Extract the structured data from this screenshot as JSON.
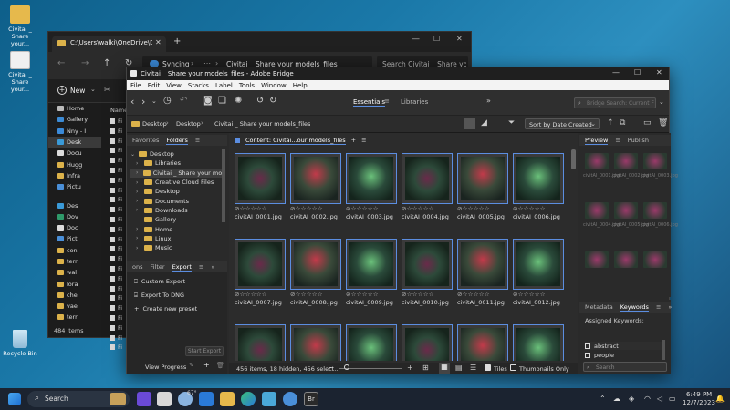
{
  "desktop": {
    "icons": [
      {
        "label": "Civitai _ Share your..."
      },
      {
        "label": "Civitai _ Share your..."
      },
      {
        "label": "Recycle Bin"
      }
    ]
  },
  "explorer": {
    "tab_title": "C:\\Users\\walki\\OneDrive\\Desk",
    "breadcrumb": [
      "Syncing",
      "Civitai _ Share your models_files"
    ],
    "search_placeholder": "Search Civitai _ Share your mo",
    "new_label": "New",
    "name_col": "Name",
    "sidebar": [
      {
        "label": "Home"
      },
      {
        "label": "Gallery"
      },
      {
        "label": "Nny - I"
      },
      {
        "label": "Desk"
      },
      {
        "label": "Docu"
      },
      {
        "label": "Hugg"
      },
      {
        "label": "Infra"
      },
      {
        "label": "Pictu"
      },
      {
        "label": "Des"
      },
      {
        "label": "Dov"
      },
      {
        "label": "Doc"
      },
      {
        "label": "Pict"
      },
      {
        "label": "con"
      },
      {
        "label": "terr"
      },
      {
        "label": "wal"
      },
      {
        "label": "lora"
      },
      {
        "label": "che"
      },
      {
        "label": "vae"
      },
      {
        "label": "terr"
      }
    ],
    "file_rows": [
      "Fi",
      "Fi",
      "Fi",
      "Fi",
      "Fi",
      "Fi",
      "Fi",
      "Fi",
      "Fi",
      "Fi",
      "Fi",
      "Fi",
      "Fi",
      "Fi",
      "Fi",
      "Fi",
      "Fi",
      "Fi",
      "Fi",
      "Fi",
      "Fi",
      "Fi",
      "Fi",
      "Fi"
    ],
    "status": "484 items"
  },
  "bridge": {
    "title": "Civitai _ Share your models_files - Adobe Bridge",
    "menu": [
      "File",
      "Edit",
      "View",
      "Stacks",
      "Label",
      "Tools",
      "Window",
      "Help"
    ],
    "workspaces": [
      "Essentials",
      "Libraries"
    ],
    "search_placeholder": "Bridge Search: Current F",
    "path": [
      "Desktop",
      "Desktop",
      "Civitai _ Share your models_files"
    ],
    "sort_label": "Sort by Date Created",
    "favorites_tab": "Favorites",
    "folders_tab": "Folders",
    "folders": [
      {
        "label": "Desktop",
        "indent": 0,
        "chev": "⌄"
      },
      {
        "label": "Libraries",
        "indent": 1,
        "chev": "›"
      },
      {
        "label": "Civitai _ Share your models",
        "indent": 1,
        "chev": "›"
      },
      {
        "label": "Creative Cloud Files",
        "indent": 1,
        "chev": "›"
      },
      {
        "label": "Desktop",
        "indent": 1,
        "chev": "›"
      },
      {
        "label": "Documents",
        "indent": 1,
        "chev": "›"
      },
      {
        "label": "Downloads",
        "indent": 1,
        "chev": "›"
      },
      {
        "label": "Gallery",
        "indent": 1,
        "chev": ""
      },
      {
        "label": "Home",
        "indent": 1,
        "chev": "›"
      },
      {
        "label": "Linux",
        "indent": 1,
        "chev": "›"
      },
      {
        "label": "Music",
        "indent": 1,
        "chev": "›"
      }
    ],
    "lower_tabs": [
      "ons",
      "Filter",
      "Export"
    ],
    "export_items": [
      "Custom Export",
      "Export To DNG",
      "Create new preset"
    ],
    "start_export": "Start Export",
    "view_progress": "View Progress",
    "content_label": "Content: Civitai...our models_files",
    "thumbnails": [
      {
        "name": "civitAI_0001.jpg"
      },
      {
        "name": "civitAI_0002.jpg"
      },
      {
        "name": "civitAI_0003.jpg"
      },
      {
        "name": "civitAI_0004.jpg"
      },
      {
        "name": "civitAI_0005.jpg"
      },
      {
        "name": "civitAI_0006.jpg"
      },
      {
        "name": "civitAI_0007.jpg"
      },
      {
        "name": "civitAI_0008.jpg"
      },
      {
        "name": "civitAI_0009.jpg"
      },
      {
        "name": "civitAI_0010.jpg"
      },
      {
        "name": "civitAI_0011.jpg"
      },
      {
        "name": "civitAI_0012.jpg"
      },
      {
        "name": ""
      },
      {
        "name": ""
      },
      {
        "name": ""
      },
      {
        "name": ""
      },
      {
        "name": ""
      },
      {
        "name": ""
      }
    ],
    "stars": "⊘☆☆☆☆☆",
    "status": "456 items, 18 hidden, 456 select...",
    "tiles_label": "Tiles",
    "thumbs_only_label": "Thumbnails Only",
    "preview_tab": "Preview",
    "publish_tab": "Publish",
    "preview_labels": [
      "civitAI_0001.jpg",
      "civitAI_0002.jpg",
      "civitAI_0003.jpg",
      "civitAI_0004.jpg",
      "civitAI_0005.jpg",
      "civitAI_0006.jpg"
    ],
    "metadata_tab": "Metadata",
    "keywords_tab": "Keywords",
    "assigned_keywords": "Assigned Keywords:",
    "keyword_items": [
      "abstract",
      "people"
    ],
    "keyword_search_placeholder": "Search"
  },
  "taskbar": {
    "search_label": "Search",
    "weather": "67°",
    "time": "6:49 PM",
    "date": "12/7/2023"
  },
  "colors": {
    "accent": "#5b8de0",
    "bridge_bg": "#2a2a2a",
    "folder": "#dcb24a",
    "taskbar": "#1b2330"
  }
}
